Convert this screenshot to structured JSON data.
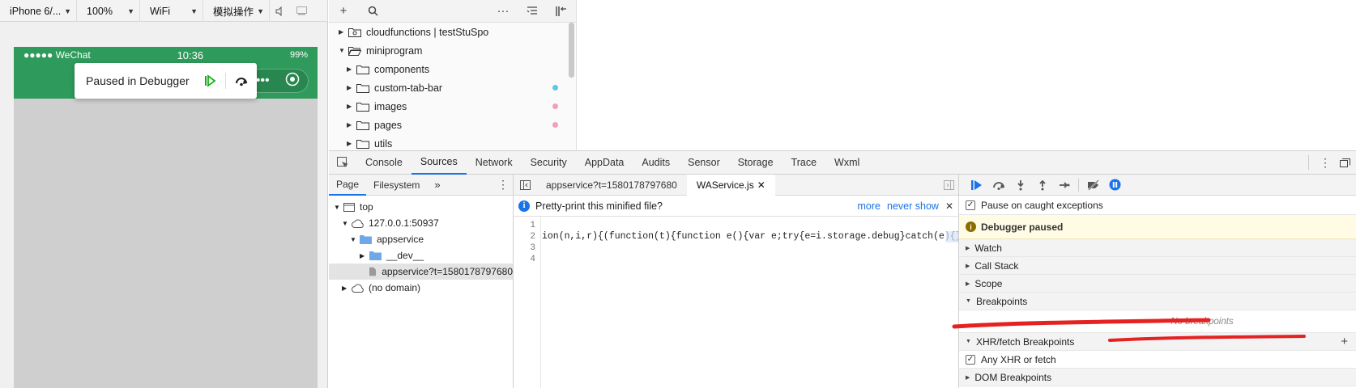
{
  "simulator": {
    "device": "iPhone 6/...",
    "zoom": "100%",
    "network": "WiFi",
    "ops": "模拟操作",
    "status_carrier": "●●●●● WeChat",
    "status_time": "10:36",
    "status_battery": "99%",
    "paused_label": "Paused in Debugger"
  },
  "filetree": {
    "items": [
      {
        "label": "cloudfunctions | testStuSpo",
        "expanded": false,
        "dot": ""
      },
      {
        "label": "miniprogram",
        "expanded": true,
        "dot": ""
      },
      {
        "label": "components",
        "expanded": false,
        "dot": ""
      },
      {
        "label": "custom-tab-bar",
        "expanded": false,
        "dot": "#5bc8e8"
      },
      {
        "label": "images",
        "expanded": false,
        "dot": "#f2a0b6"
      },
      {
        "label": "pages",
        "expanded": false,
        "dot": "#f2a0b6"
      },
      {
        "label": "utils",
        "expanded": false,
        "dot": ""
      }
    ]
  },
  "devtools": {
    "tabs": [
      "Console",
      "Sources",
      "Network",
      "Security",
      "AppData",
      "Audits",
      "Sensor",
      "Storage",
      "Trace",
      "Wxml"
    ],
    "active_tab": "Sources"
  },
  "navigator": {
    "tab_page": "Page",
    "tab_filesystem": "Filesystem",
    "tree": {
      "top": "top",
      "host": "127.0.0.1:50937",
      "folder": "appservice",
      "dev": "__dev__",
      "file": "appservice?t=1580178797680",
      "nodomain": "(no domain)"
    }
  },
  "editor": {
    "tab1": "appservice?t=1580178797680",
    "tab2": "WAService.js",
    "info_text": "Pretty-print this minified file?",
    "info_more": "more",
    "info_never": "never show",
    "line_numbers": [
      "1",
      "2",
      "3",
      "4"
    ],
    "code_line2": "ion(n,i,r){(function(t){function e(){var e;try{e=i.storage.debug}catch(e){}re"
  },
  "debugger": {
    "pause_on_caught": "Pause on caught exceptions",
    "paused_msg": "Debugger paused",
    "sections": {
      "watch": "Watch",
      "callstack": "Call Stack",
      "scope": "Scope",
      "breakpoints": "Breakpoints",
      "xhr": "XHR/fetch Breakpoints",
      "dom": "DOM Breakpoints"
    },
    "no_breakpoints": "No breakpoints",
    "any_xhr": "Any XHR or fetch"
  },
  "colors": {
    "wechat_green": "#2e9a5b",
    "accent_blue": "#1a73e8",
    "annotation_red": "#e52222"
  }
}
